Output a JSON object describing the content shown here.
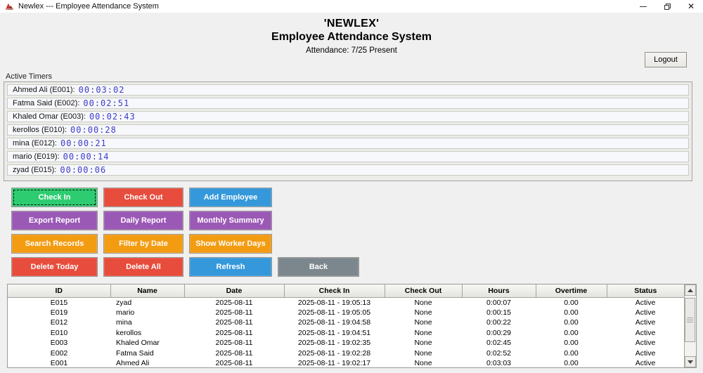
{
  "window": {
    "title": "Newlex --- Employee Attendance System"
  },
  "header": {
    "brand": "'NEWLEX'",
    "title": "Employee Attendance System",
    "attendance": "Attendance: 7/25 Present"
  },
  "logout_label": "Logout",
  "timers": {
    "label": "Active Timers",
    "items": [
      {
        "label": "Ahmed Ali (E001):",
        "time": "00:03:02"
      },
      {
        "label": "Fatma Said (E002):",
        "time": "00:02:51"
      },
      {
        "label": "Khaled Omar (E003):",
        "time": "00:02:43"
      },
      {
        "label": "kerollos (E010):",
        "time": "00:00:28"
      },
      {
        "label": "mina (E012):",
        "time": "00:00:21"
      },
      {
        "label": "mario (E019):",
        "time": "00:00:14"
      },
      {
        "label": "zyad (E015):",
        "time": "00:00:06"
      }
    ]
  },
  "buttons": {
    "check_in": "Check In",
    "check_out": "Check Out",
    "add_employee": "Add Employee",
    "export_report": "Export Report",
    "daily_report": "Daily Report",
    "monthly_summary": "Monthly Summary",
    "search_records": "Search Records",
    "filter_by_date": "Filter by Date",
    "show_worker_days": "Show Worker Days",
    "delete_today": "Delete Today",
    "delete_all": "Delete All",
    "refresh": "Refresh",
    "back": "Back"
  },
  "colors": {
    "green": "#2ecc71",
    "red": "#e74c3c",
    "blue": "#3498db",
    "purple": "#9b59b6",
    "orange": "#f39c12",
    "gray": "#7c878d",
    "timer_time": "#3c3ccc"
  },
  "table": {
    "columns": [
      "ID",
      "Name",
      "Date",
      "Check In",
      "Check Out",
      "Hours",
      "Overtime",
      "Status"
    ],
    "rows": [
      {
        "id": "E015",
        "name": "zyad",
        "date": "2025-08-11",
        "check_in": "2025-08-11 - 19:05:13",
        "check_out": "None",
        "hours": "0:00:07",
        "overtime": "0.00",
        "status": "Active"
      },
      {
        "id": "E019",
        "name": "mario",
        "date": "2025-08-11",
        "check_in": "2025-08-11 - 19:05:05",
        "check_out": "None",
        "hours": "0:00:15",
        "overtime": "0.00",
        "status": "Active"
      },
      {
        "id": "E012",
        "name": "mina",
        "date": "2025-08-11",
        "check_in": "2025-08-11 - 19:04:58",
        "check_out": "None",
        "hours": "0:00:22",
        "overtime": "0.00",
        "status": "Active"
      },
      {
        "id": "E010",
        "name": "kerollos",
        "date": "2025-08-11",
        "check_in": "2025-08-11 - 19:04:51",
        "check_out": "None",
        "hours": "0:00:29",
        "overtime": "0.00",
        "status": "Active"
      },
      {
        "id": "E003",
        "name": "Khaled Omar",
        "date": "2025-08-11",
        "check_in": "2025-08-11 - 19:02:35",
        "check_out": "None",
        "hours": "0:02:45",
        "overtime": "0.00",
        "status": "Active"
      },
      {
        "id": "E002",
        "name": "Fatma Said",
        "date": "2025-08-11",
        "check_in": "2025-08-11 - 19:02:28",
        "check_out": "None",
        "hours": "0:02:52",
        "overtime": "0.00",
        "status": "Active"
      },
      {
        "id": "E001",
        "name": "Ahmed Ali",
        "date": "2025-08-11",
        "check_in": "2025-08-11 - 19:02:17",
        "check_out": "None",
        "hours": "0:03:03",
        "overtime": "0.00",
        "status": "Active"
      }
    ]
  }
}
